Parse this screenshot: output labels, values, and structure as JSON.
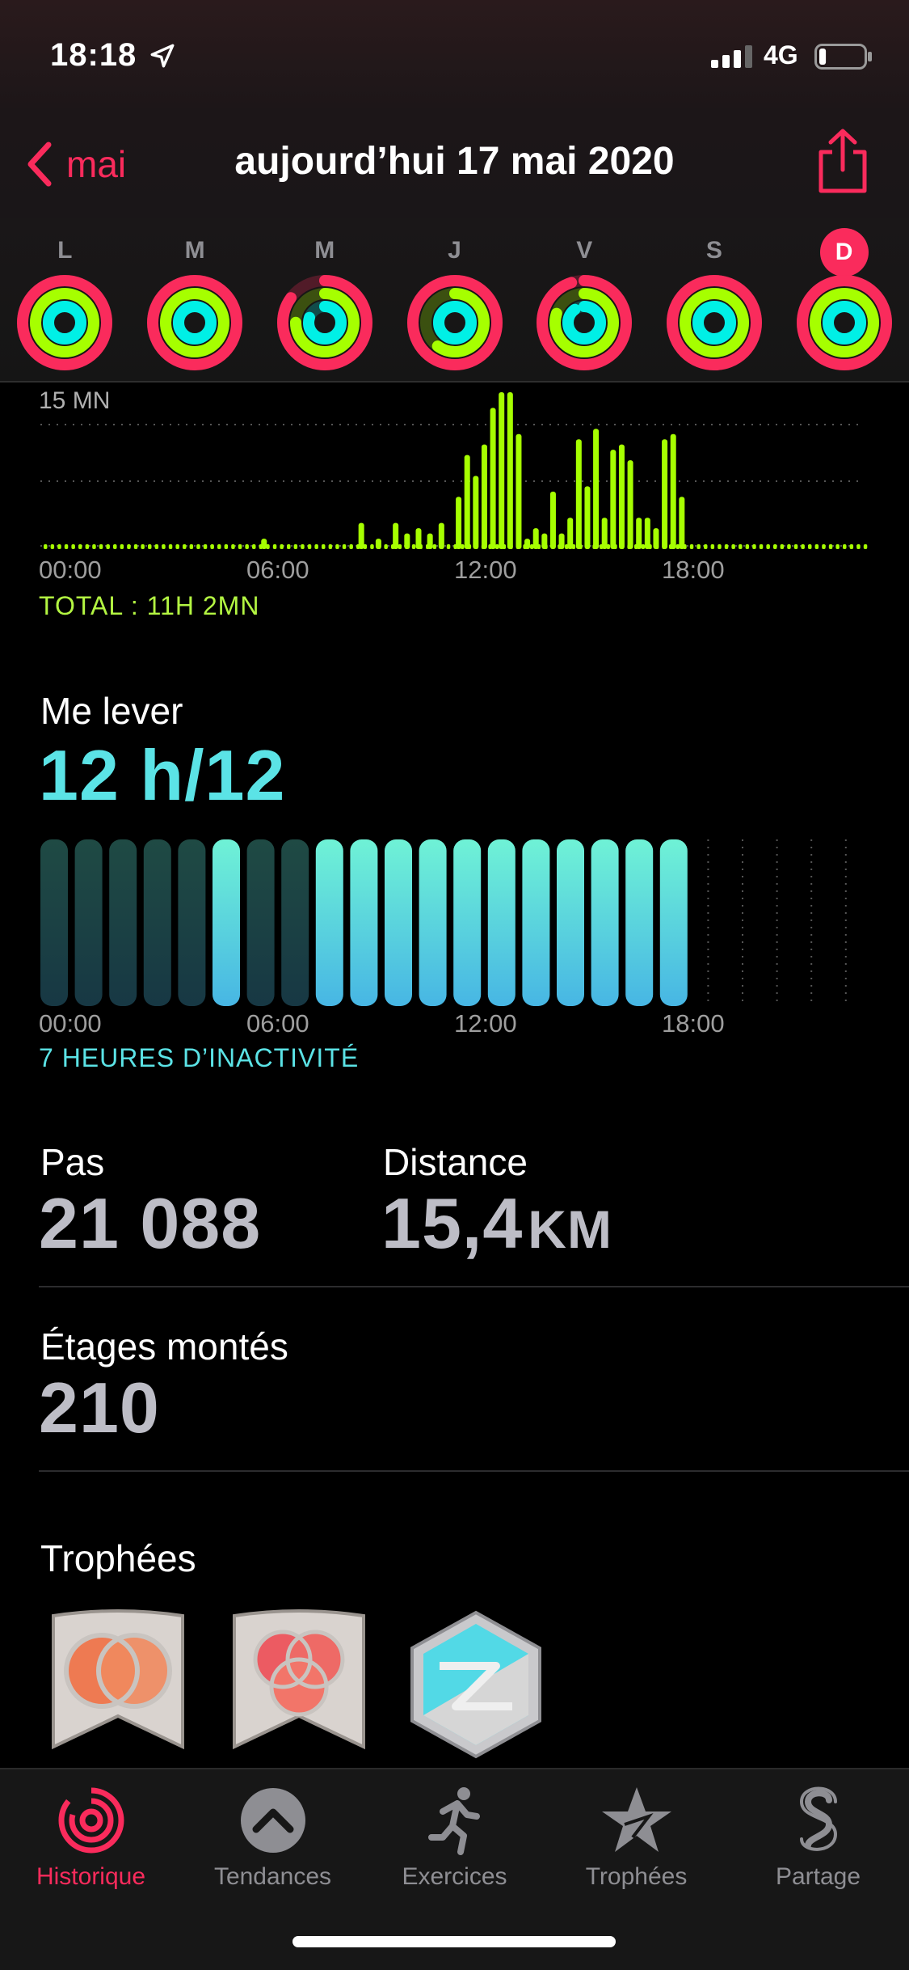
{
  "status_bar": {
    "time": "18:18",
    "network": "4G",
    "location_icon": "location-arrow-icon",
    "battery_level": 0.15
  },
  "header": {
    "back_label": "mai",
    "title": "aujourd’hui 17 mai 2020",
    "share_icon": "share-icon"
  },
  "week": {
    "days": [
      {
        "label": "L",
        "today": false,
        "move": 1.0,
        "exercise": 1.0,
        "stand": 1.0
      },
      {
        "label": "M",
        "today": false,
        "move": 1.0,
        "exercise": 1.0,
        "stand": 1.0
      },
      {
        "label": "M",
        "today": false,
        "move": 0.85,
        "exercise": 0.75,
        "stand": 0.8
      },
      {
        "label": "J",
        "today": false,
        "move": 1.0,
        "exercise": 0.6,
        "stand": 1.0
      },
      {
        "label": "V",
        "today": false,
        "move": 0.95,
        "exercise": 0.8,
        "stand": 0.9
      },
      {
        "label": "S",
        "today": false,
        "move": 1.0,
        "exercise": 1.0,
        "stand": 1.0
      },
      {
        "label": "D",
        "today": true,
        "move": 1.0,
        "exercise": 1.0,
        "stand": 1.0
      }
    ],
    "colors": {
      "move": "#fa2b5c",
      "exercise": "#a6ff00",
      "stand": "#00f0e6"
    }
  },
  "exercise_chart": {
    "y_label": "15 MN",
    "x_labels": [
      "00:00",
      "06:00",
      "12:00",
      "18:00"
    ],
    "total": "TOTAL : 11H 2MN",
    "color": "#a6ff00"
  },
  "chart_data": [
    {
      "type": "bar",
      "title": "",
      "x_labels": [
        "00:00",
        "06:00",
        "12:00",
        "18:00"
      ],
      "ylabel": "15 MN",
      "ylim": [
        0,
        15
      ],
      "x_range_minutes": [
        0,
        1440
      ],
      "bins": [
        {
          "minute": 390,
          "value": 1.0
        },
        {
          "minute": 560,
          "value": 2.5
        },
        {
          "minute": 590,
          "value": 1.0
        },
        {
          "minute": 620,
          "value": 2.5
        },
        {
          "minute": 640,
          "value": 1.5
        },
        {
          "minute": 660,
          "value": 2.0
        },
        {
          "minute": 680,
          "value": 1.5
        },
        {
          "minute": 700,
          "value": 2.5
        },
        {
          "minute": 730,
          "value": 5.0
        },
        {
          "minute": 745,
          "value": 9.0
        },
        {
          "minute": 760,
          "value": 7.0
        },
        {
          "minute": 775,
          "value": 10.0
        },
        {
          "minute": 790,
          "value": 13.5
        },
        {
          "minute": 805,
          "value": 15.0
        },
        {
          "minute": 820,
          "value": 15.0
        },
        {
          "minute": 835,
          "value": 11.0
        },
        {
          "minute": 850,
          "value": 1.0
        },
        {
          "minute": 865,
          "value": 2.0
        },
        {
          "minute": 880,
          "value": 1.5
        },
        {
          "minute": 895,
          "value": 5.5
        },
        {
          "minute": 910,
          "value": 1.5
        },
        {
          "minute": 925,
          "value": 3.0
        },
        {
          "minute": 940,
          "value": 10.5
        },
        {
          "minute": 955,
          "value": 6.0
        },
        {
          "minute": 970,
          "value": 11.5
        },
        {
          "minute": 985,
          "value": 3.0
        },
        {
          "minute": 1000,
          "value": 9.5
        },
        {
          "minute": 1015,
          "value": 10.0
        },
        {
          "minute": 1030,
          "value": 8.5
        },
        {
          "minute": 1045,
          "value": 3.0
        },
        {
          "minute": 1060,
          "value": 3.0
        },
        {
          "minute": 1075,
          "value": 2.0
        },
        {
          "minute": 1090,
          "value": 10.5
        },
        {
          "minute": 1105,
          "value": 11.0
        },
        {
          "minute": 1120,
          "value": 5.0
        }
      ]
    },
    {
      "type": "bar",
      "title": "",
      "x_labels": [
        "00:00",
        "06:00",
        "12:00",
        "18:00"
      ],
      "hours": [
        0,
        1,
        2,
        3,
        4,
        5,
        6,
        7,
        8,
        9,
        10,
        11,
        12,
        13,
        14,
        15,
        16,
        17,
        18,
        19,
        20,
        21,
        22,
        23
      ],
      "stood": [
        0,
        0,
        0,
        0,
        0,
        1,
        0,
        0,
        1,
        1,
        1,
        1,
        1,
        1,
        1,
        1,
        1,
        1,
        1,
        null,
        null,
        null,
        null,
        null
      ]
    }
  ],
  "stand": {
    "title": "Me lever",
    "value": "12  h/12",
    "footer": "7 HEURES D’INACTIVITÉ"
  },
  "stats": {
    "steps_label": "Pas",
    "steps_value": "21 088",
    "distance_label": "Distance",
    "distance_value": "15,4",
    "distance_unit": "KM",
    "floors_label": "Étages montés",
    "floors_value": "210"
  },
  "trophies": {
    "title": "Trophées",
    "items": [
      {
        "name": "ring-badge-2-icon"
      },
      {
        "name": "ring-badge-3-icon"
      },
      {
        "name": "lightning-badge-icon"
      }
    ]
  },
  "tabbar": {
    "tabs": [
      {
        "label": "Historique",
        "icon": "rings-icon",
        "active": true
      },
      {
        "label": "Tendances",
        "icon": "trends-chevron-icon",
        "active": false
      },
      {
        "label": "Exercices",
        "icon": "runner-icon",
        "active": false
      },
      {
        "label": "Trophées",
        "icon": "star-badge-icon",
        "active": false
      },
      {
        "label": "Partage",
        "icon": "share-s-icon",
        "active": false
      }
    ]
  }
}
